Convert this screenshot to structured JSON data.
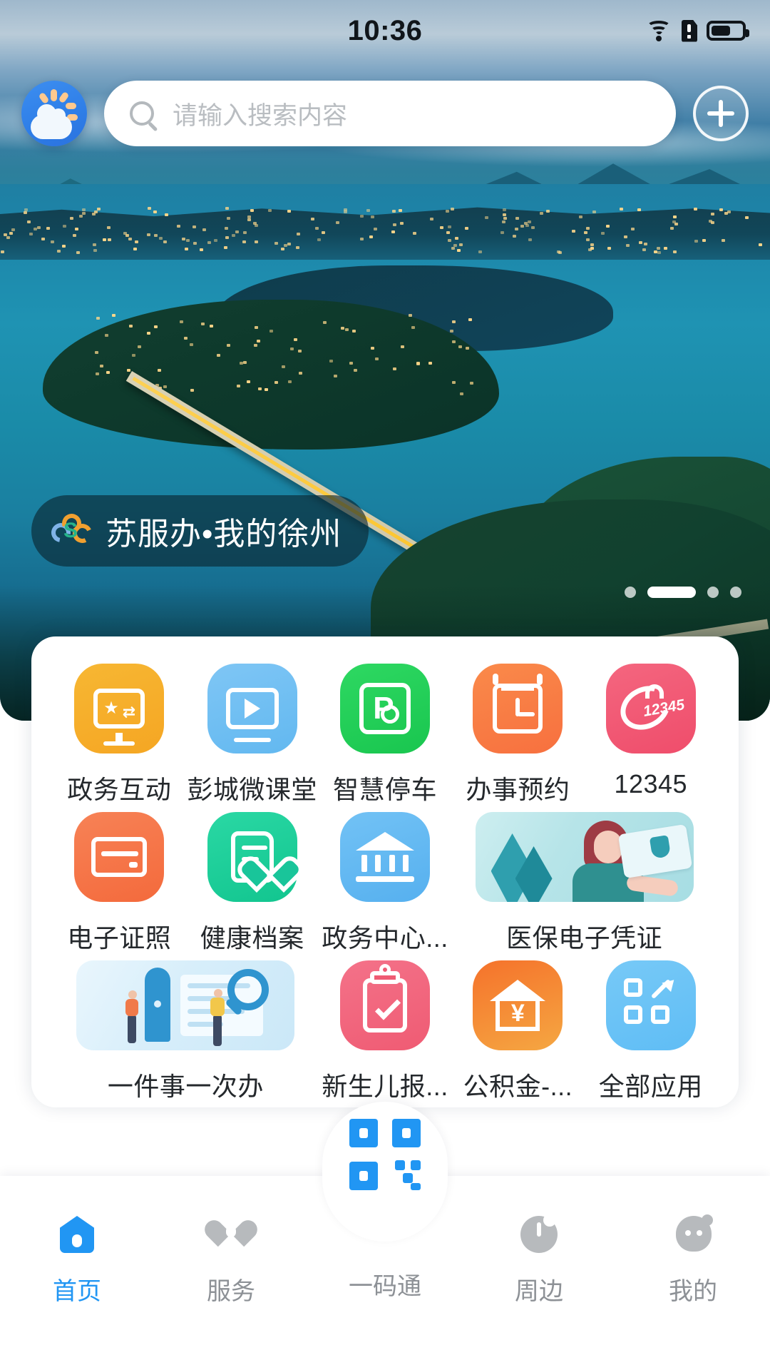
{
  "status_bar": {
    "time": "10:36",
    "icons": [
      "wifi-icon",
      "sim-alert-icon",
      "battery-icon"
    ],
    "battery_level": "60"
  },
  "header": {
    "weather_button": "weather-icon",
    "search": {
      "placeholder": "请输入搜索内容",
      "value": "",
      "icon": "search-icon"
    },
    "add_button": "plus-icon"
  },
  "banner": {
    "badge_text": "苏服办•我的徐州",
    "badge_logo": "su-fu-ban-logo-icon",
    "dots": {
      "count": 4,
      "active_index": 1
    }
  },
  "apps": {
    "rows": [
      [
        {
          "label": "政务互动",
          "icon": "monitor-star-exchange-icon",
          "color": "#f5a623",
          "color2": "#f7b733",
          "wide": false
        },
        {
          "label": "彭城微课堂",
          "icon": "video-play-icon",
          "color": "#62b8f0",
          "color2": "#7fc6f5",
          "wide": false
        },
        {
          "label": "智慧停车",
          "icon": "parking-p-icon",
          "color": "#19c64f",
          "color2": "#2ed862",
          "wide": false
        },
        {
          "label": "办事预约",
          "icon": "calendar-clock-icon",
          "color": "#f7703f",
          "color2": "#fa8a4a",
          "wide": false
        },
        {
          "label": "12345",
          "icon": "hotline-12345-icon",
          "color": "#ef4d6b",
          "color2": "#f4667f",
          "wide": false
        }
      ],
      [
        {
          "label": "电子证照",
          "icon": "id-card-icon",
          "color": "#f46a3c",
          "color2": "#f78256",
          "wide": false
        },
        {
          "label": "健康档案",
          "icon": "health-record-icon",
          "color": "#12c58f",
          "color2": "#2ad8a4",
          "wide": false
        },
        {
          "label": "政务中心...",
          "icon": "government-hall-icon",
          "color": "#56b0ef",
          "color2": "#72c2f5",
          "wide": false
        },
        {
          "label": "医保电子凭证",
          "icon": "medical-insurance-illustration",
          "color": "#bfe8ec",
          "color2": "#a9dde3",
          "wide": true
        }
      ],
      [
        {
          "label": "一件事一次办",
          "icon": "one-thing-one-time-illustration",
          "color": "#e3f2fb",
          "color2": "#cfe9f8",
          "wide": true
        },
        {
          "label": "新生儿报...",
          "icon": "newborn-clipboard-check-icon",
          "color": "#ef5b73",
          "color2": "#f47289",
          "wide": false
        },
        {
          "label": "公积金-...",
          "icon": "housing-fund-yuan-icon",
          "color": "#f5a742",
          "color2": "#f5722b",
          "wide": false
        },
        {
          "label": "全部应用",
          "icon": "all-apps-grid-icon",
          "color": "#5fbdf5",
          "color2": "#77c9f7",
          "wide": false
        }
      ]
    ]
  },
  "bottom_nav": {
    "items": [
      {
        "label": "首页",
        "icon": "home-icon",
        "active": true
      },
      {
        "label": "服务",
        "icon": "heart-icon",
        "active": false
      },
      {
        "label": "一码通",
        "icon": "qrcode-icon",
        "active": false
      },
      {
        "label": "周边",
        "icon": "compass-icon",
        "active": false
      },
      {
        "label": "我的",
        "icon": "profile-icon",
        "active": false
      }
    ],
    "active_color": "#2196f3",
    "inactive_color": "#8d9196"
  }
}
